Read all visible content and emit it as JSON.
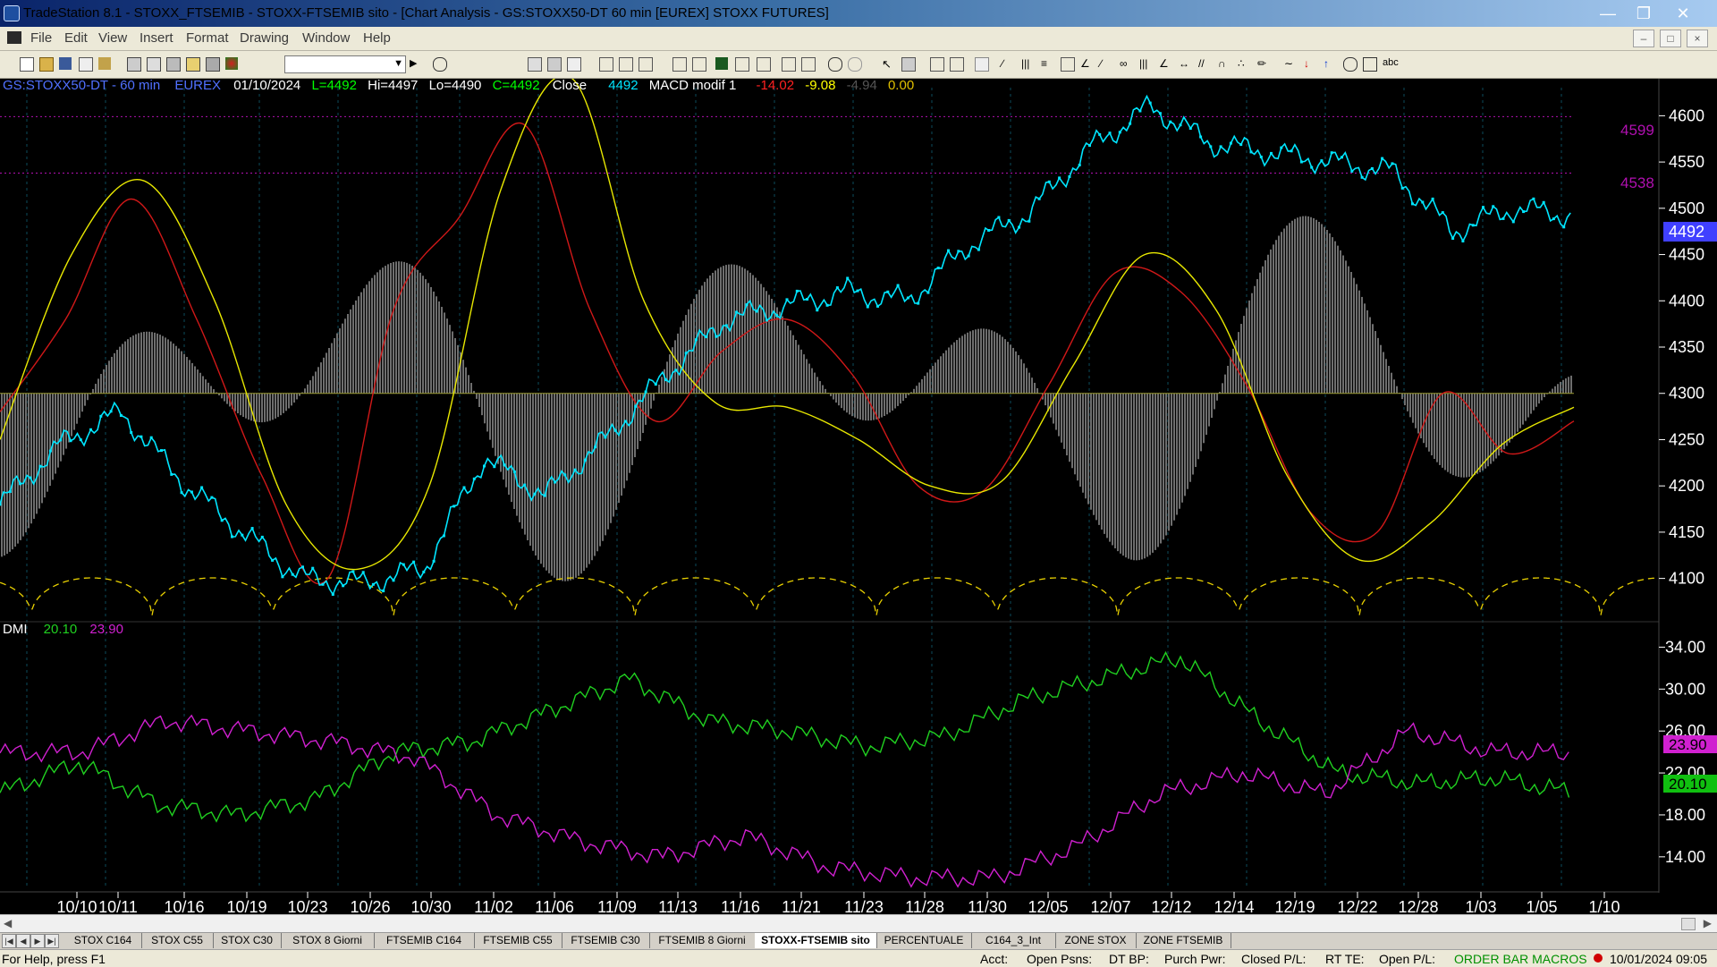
{
  "window": {
    "title": "TradeStation 8.1 - STOXX_FTSEMIB - STOXX-FTSEMIB sito - [Chart Analysis - GS:STOXX50-DT  60 min  [EUREX] STOXX FUTURES]",
    "min_icon": "minimize-icon",
    "max_icon": "maximize-icon",
    "close_icon": "close-icon"
  },
  "menu": {
    "items": [
      "File",
      "Edit",
      "View",
      "Insert",
      "Format",
      "Drawing",
      "Window",
      "Help"
    ]
  },
  "toolbar": {
    "combo_value": "",
    "left_icons": [
      "new-icon",
      "open-icon",
      "save-icon",
      "folder-icon",
      "print-icon",
      "print-preview-icon",
      "properties-icon",
      "lock-icon",
      "tools-icon",
      "shapes-icon"
    ],
    "right_icons": [
      "bar-icon",
      "format-icon",
      "data-window-icon",
      "zoom-in-icon",
      "zoom-out-icon",
      "cursor-icon",
      "hand-icon",
      "trendline-icon",
      "fib-icon",
      "text-icon"
    ]
  },
  "colors": {
    "price": "#00e5ff",
    "macd_red": "#d01818",
    "macd_yellow": "#e8e800",
    "hist": "#6e6e6e",
    "dmi_green": "#20d020",
    "dmi_magenta": "#d020d0",
    "cycle": "#e8d000",
    "hline": "#9a9a30",
    "level": "#b010b0",
    "current_price_bg": "#4040ff"
  },
  "chart": {
    "header": {
      "symbol": "GS:STOXX50-DT - 60 min",
      "exchange": "EUREX",
      "date": "01/10/2024",
      "last": "L=4492",
      "hi": "Hi=4497",
      "lo": "Lo=4490",
      "close": "C=4492",
      "close_label": "Close",
      "close_value": "4492",
      "indicator": "MACD modif 1",
      "v1": "-14.02",
      "v2": "-9.08",
      "v3": "-4.94",
      "v4": "0.00"
    },
    "dmi_header": {
      "label": "DMI",
      "v1": "20.10",
      "v2": "23.90"
    },
    "price_axis": [
      "4600",
      "4550",
      "4500",
      "4450",
      "4400",
      "4350",
      "4300",
      "4250",
      "4200",
      "4150",
      "4100"
    ],
    "level_labels": [
      "4599",
      "4538"
    ],
    "current_price": "4492",
    "dmi_axis": [
      "34.00",
      "30.00",
      "26.00",
      "22.00",
      "18.00",
      "14.00"
    ],
    "dmi_current": {
      "magenta": "23.90",
      "green": "20.10"
    },
    "date_axis": [
      "10/10",
      "10/11",
      "10/16",
      "10/19",
      "10/23",
      "10/26",
      "10/30",
      "11/02",
      "11/06",
      "11/09",
      "11/13",
      "11/16",
      "11/21",
      "11/23",
      "11/28",
      "11/30",
      "12/05",
      "12/07",
      "12/12",
      "12/14",
      "12/19",
      "12/22",
      "12/28",
      "1/03",
      "1/05",
      "1/10"
    ]
  },
  "chart_data": {
    "type": "line",
    "price_panel": {
      "ylim": [
        4060,
        4640
      ],
      "price": {
        "x_dates": [
          "10/06",
          "10/10",
          "10/11",
          "10/16",
          "10/19",
          "10/23",
          "10/26",
          "10/30",
          "11/02",
          "11/06",
          "11/09",
          "11/13",
          "11/16",
          "11/21",
          "11/23",
          "11/28",
          "11/30",
          "12/05",
          "12/07",
          "12/12",
          "12/14",
          "12/19",
          "12/22",
          "12/28",
          "1/03",
          "1/05",
          "1/10"
        ],
        "values": [
          4180,
          4245,
          4280,
          4205,
          4150,
          4100,
          4095,
          4110,
          4230,
          4190,
          4250,
          4320,
          4380,
          4395,
          4410,
          4400,
          4460,
          4495,
          4565,
          4610,
          4570,
          4560,
          4550,
          4540,
          4475,
          4500,
          4492
        ]
      },
      "macd_red": [
        4280,
        4380,
        4510,
        4380,
        4210,
        4100,
        4390,
        4490,
        4590,
        4390,
        4270,
        4345,
        4380,
        4320,
        4200,
        4195,
        4310,
        4430,
        4410,
        4310,
        4170,
        4150,
        4300,
        4235,
        4270
      ],
      "macd_yellow": [
        4250,
        4450,
        4530,
        4400,
        4180,
        4110,
        4200,
        4520,
        4640,
        4400,
        4290,
        4285,
        4250,
        4200,
        4205,
        4330,
        4450,
        4390,
        4210,
        4120,
        4160,
        4245,
        4285
      ],
      "levels": [
        4599,
        4538
      ],
      "zero_line": 4300
    },
    "dmi_panel": {
      "ylim": [
        11,
        36
      ],
      "green": [
        20.1,
        23,
        19,
        18,
        19.5,
        24,
        25,
        28,
        31,
        27,
        26,
        24.5,
        25.5,
        29,
        31,
        33,
        27,
        22,
        21,
        21.5,
        20.1
      ],
      "magenta": [
        23.9,
        24,
        27,
        26,
        25,
        23.5,
        18,
        15.5,
        14,
        16,
        13,
        12,
        12,
        15,
        20,
        22,
        20,
        26,
        24,
        23.9
      ]
    }
  },
  "tabs": [
    "STOX C164",
    "STOX C55",
    "STOX  C30",
    "STOX  8 Giorni",
    "FTSEMIB C164",
    "FTSEMIB C55",
    "FTSEMIB C30",
    "FTSEMIB  8 Giorni",
    "STOXX-FTSEMIB sito",
    "PERCENTUALE",
    "C164_3_Int",
    "ZONE STOX",
    "ZONE FTSEMIB"
  ],
  "active_tab": "STOXX-FTSEMIB sito",
  "status": {
    "help": "For Help, press F1",
    "acct": "Acct:",
    "open_psns": "Open Psns:",
    "dt_bp": "DT BP:",
    "purch_pwr": "Purch Pwr:",
    "closed_pl": "Closed P/L:",
    "rt_te": "RT TE:",
    "open_pl": "Open P/L:",
    "macros": "ORDER BAR  MACROS",
    "clock": "10/01/2024 09:05"
  }
}
